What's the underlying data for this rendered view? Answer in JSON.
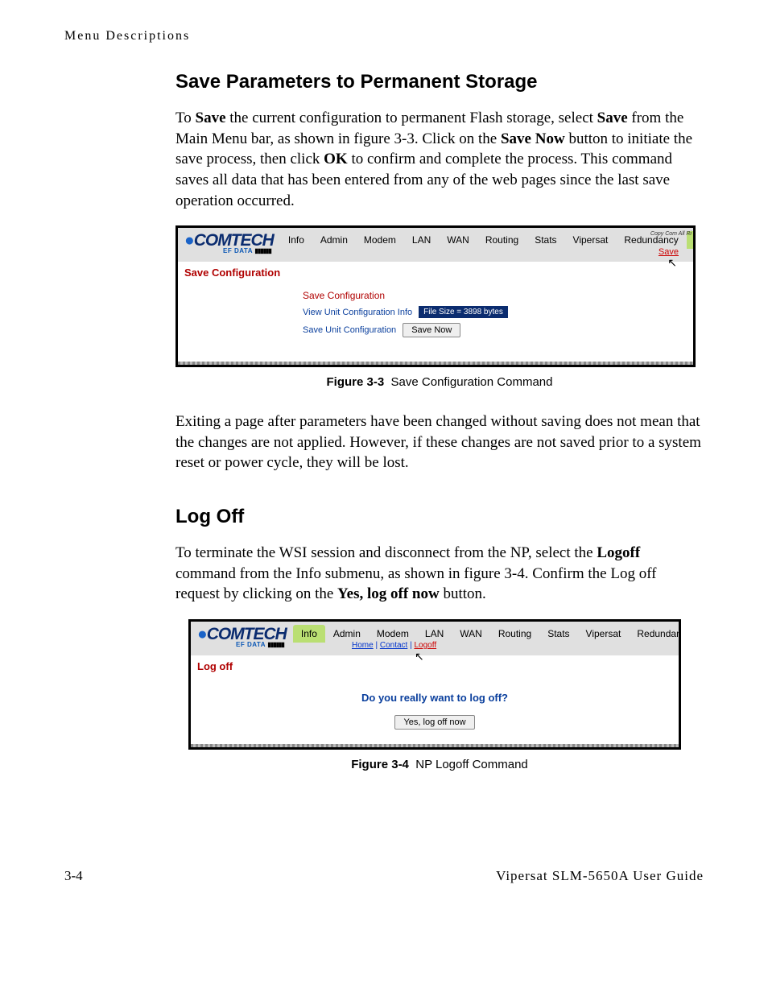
{
  "header": "Menu Descriptions",
  "sections": {
    "save": {
      "title": "Save Parameters to Permanent Storage",
      "para_html": "To <b>Save</b> the current configuration to permanent Flash storage, select <b>Save</b> from the Main Menu bar, as shown in figure 3-3. Click on the <b>Save Now</b> button to initiate the save process, then click <b>OK</b> to confirm and complete the process. This command saves all data that has been entered from any of the web pages since the last save operation occurred.",
      "figure_label": "Figure 3-3",
      "figure_caption": "Save Configuration Command",
      "para2": "Exiting a page after parameters have been changed without saving does not mean that the changes are not applied. However, if these changes are not saved prior to a system reset or power cycle, they will be lost."
    },
    "logoff": {
      "title": "Log Off",
      "para_html": "To terminate the WSI session and disconnect from the NP, select the <b>Logoff</b> command from the Info submenu, as shown in figure 3-4. Confirm the Log off request by clicking on the <b>Yes, log off now</b> button.",
      "figure_label": "Figure 3-4",
      "figure_caption": "NP Logoff Command"
    }
  },
  "shot_common": {
    "logo_main": "COMTECH",
    "logo_sub": "EF DATA",
    "menu": [
      "Info",
      "Admin",
      "Modem",
      "LAN",
      "WAN",
      "Routing",
      "Stats",
      "Vipersat",
      "Redundancy",
      "Save"
    ],
    "copy_text": "Copy\nCom\nAll Ri"
  },
  "shot_save": {
    "page_title": "Save Configuration",
    "panel_title": "Save Configuration",
    "row1_label": "View Unit Configuration Info",
    "row1_value": "File Size = 3898 bytes",
    "row2_label": "Save Unit Configuration",
    "btn": "Save Now",
    "save_link": "Save"
  },
  "shot_logoff": {
    "page_title": "Log off",
    "sublinks": {
      "home": "Home",
      "contact": "Contact",
      "logoff": "Logoff"
    },
    "prompt": "Do you really want to log off?",
    "btn": "Yes, log off now"
  },
  "footer": {
    "left": "3-4",
    "right": "Vipersat SLM-5650A User Guide"
  }
}
